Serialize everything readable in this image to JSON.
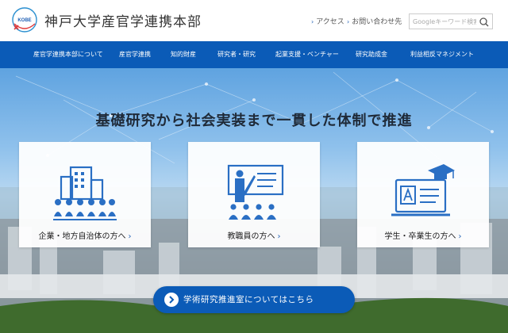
{
  "header": {
    "logo_text": "KOBE",
    "site_title": "神戸大学産官学連携本部",
    "links": [
      {
        "label": "アクセス"
      },
      {
        "label": "お問い合わせ先"
      }
    ],
    "search": {
      "placeholder": "Googleキーワード検索",
      "value": ""
    }
  },
  "nav": {
    "items": [
      {
        "label": "産官学連携本部について"
      },
      {
        "label": "産官学連携"
      },
      {
        "label": "知的財産"
      },
      {
        "label": "研究者・研究"
      },
      {
        "label": "起業支援・ベンチャー"
      },
      {
        "label": "研究助成金"
      },
      {
        "label": "利益相反マネジメント"
      }
    ],
    "background_color": "#0b5bb7"
  },
  "hero": {
    "tagline": "基礎研究から社会実装まで一貫した体制で推進",
    "cards": [
      {
        "label": "企業・地方自治体の方へ",
        "icon": "people-building-icon"
      },
      {
        "label": "教職員の方へ",
        "icon": "teacher-presentation-icon"
      },
      {
        "label": "学生・卒業生の方へ",
        "icon": "graduation-computer-icon"
      }
    ],
    "cta": {
      "label": "学術研究推進室についてはこちら"
    }
  },
  "colors": {
    "accent": "#1e5fb4",
    "icon_blue": "#2a6fc4",
    "cta_bg": "#0b5bb7"
  }
}
